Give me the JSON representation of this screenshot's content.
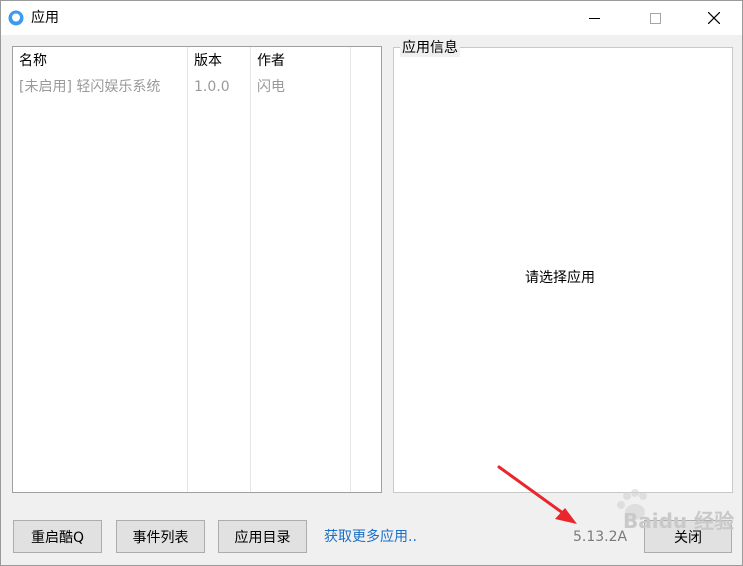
{
  "window": {
    "title": "应用",
    "controls": {
      "minimize_icon": "minimize-icon",
      "maximize_icon": "maximize-icon",
      "close_icon": "close-icon"
    }
  },
  "app_list": {
    "columns": [
      "名称",
      "版本",
      "作者"
    ],
    "rows": [
      {
        "name": "[未启用] 轻闪娱乐系统",
        "version": "1.0.0",
        "author": "闪电"
      }
    ]
  },
  "info_panel": {
    "title": "应用信息",
    "placeholder": "请选择应用"
  },
  "footer": {
    "restart_label": "重启酷Q",
    "events_label": "事件列表",
    "appdir_label": "应用目录",
    "more_apps_link": "获取更多应用..",
    "version": "5.13.2A",
    "close_label": "关闭"
  },
  "watermark": {
    "text": "Baidu 经验"
  },
  "colors": {
    "link": "#1a6fc7",
    "annotation_arrow": "#e8262b",
    "disabled_text": "#9a9a9a"
  }
}
